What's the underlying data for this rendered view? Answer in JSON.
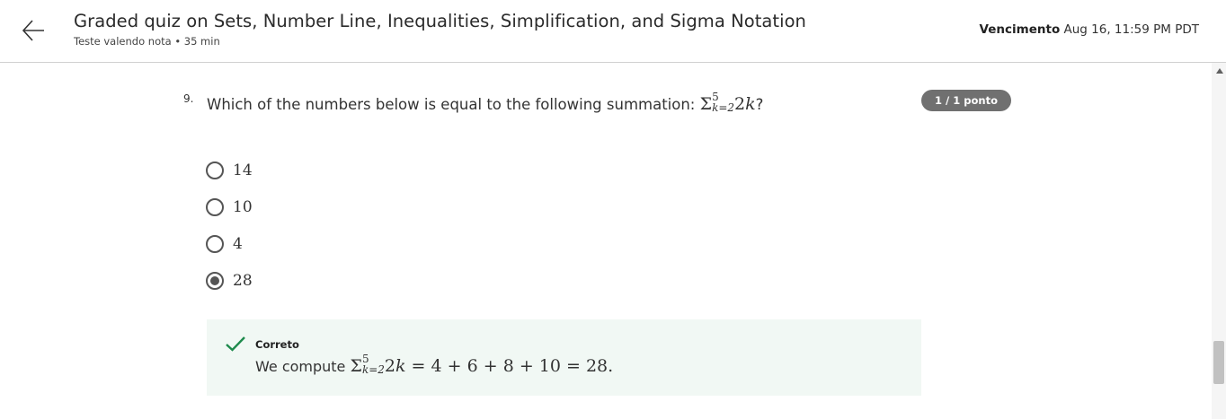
{
  "header": {
    "title": "Graded quiz on Sets, Number Line, Inequalities, Simplification, and Sigma Notation",
    "subtitle": "Teste valendo nota • 35 min",
    "due_label": "Vencimento",
    "due_value": "Aug 16, 11:59 PM PDT"
  },
  "question": {
    "number": "9.",
    "text": "Which of the numbers below is equal to the following summation:",
    "sigma": "Σ",
    "upper": "5",
    "lower": "k=2",
    "expr_num": "2",
    "expr_var": "k",
    "end": "?",
    "points": "1 / 1 ponto"
  },
  "options": [
    {
      "label": "14",
      "checked": false
    },
    {
      "label": "10",
      "checked": false
    },
    {
      "label": "4",
      "checked": false
    },
    {
      "label": "28",
      "checked": true
    }
  ],
  "feedback": {
    "status": "Correto",
    "text_prefix": "We compute",
    "sigma": "Σ",
    "upper": "5",
    "lower": "k=2",
    "expr_num": "2",
    "expr_var": "k",
    "result": " = 4 + 6 + 8 + 10 = 28."
  },
  "colors": {
    "badge": "#707070",
    "feedback_bg": "#f1f8f4",
    "check": "#1e8a4c"
  },
  "icons": {
    "back": "arrow-left-icon",
    "check": "check-icon"
  }
}
